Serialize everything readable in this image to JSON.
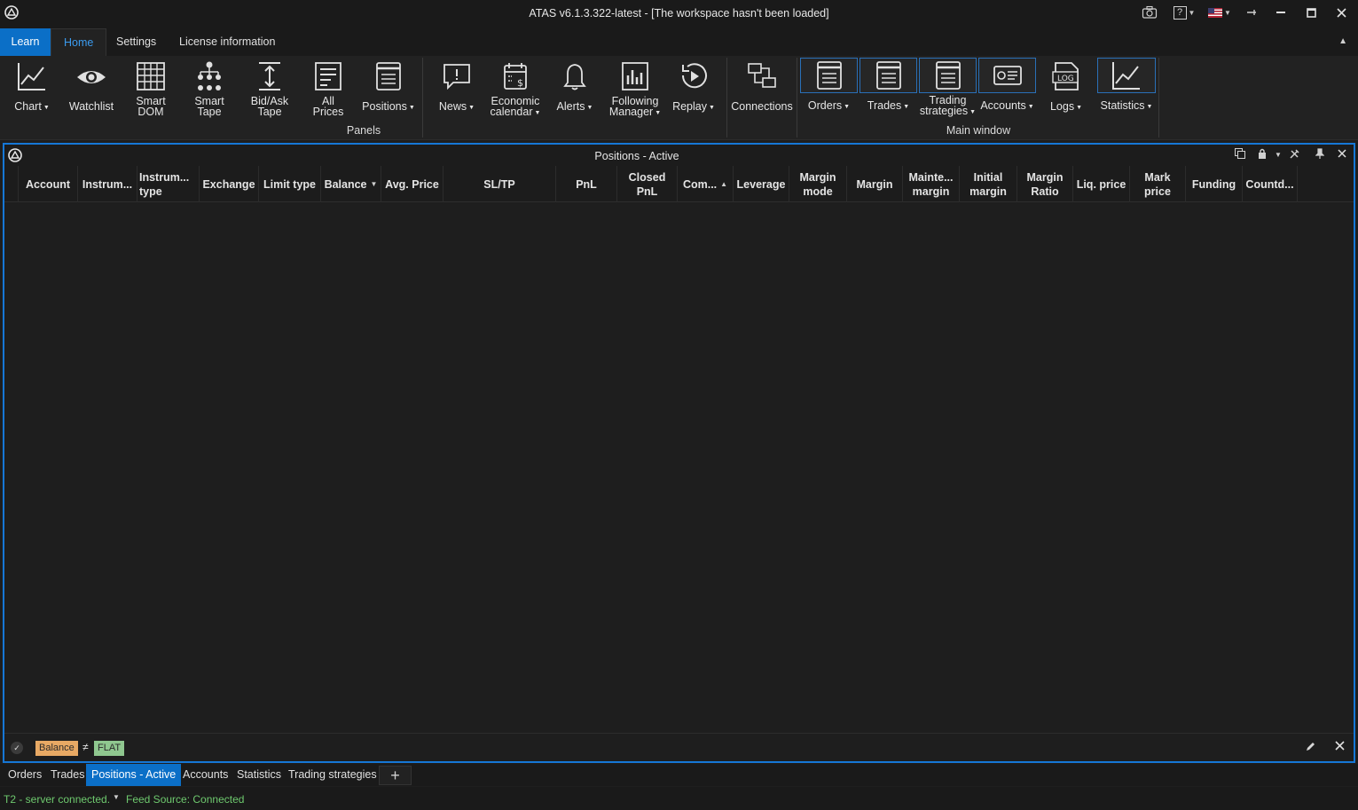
{
  "window": {
    "title": "ATAS v6.1.3.322-latest - [The workspace hasn't been loaded]"
  },
  "titlebar_icons": [
    "camera-icon",
    "help-icon",
    "flag-us-icon",
    "pin-icon",
    "minimize-icon",
    "maximize-icon",
    "close-icon"
  ],
  "ribbon_tabs": {
    "learn": "Learn",
    "home": "Home",
    "settings": "Settings",
    "license": "License information"
  },
  "ribbon": {
    "chart": "Chart",
    "watchlist": "Watchlist",
    "smart_dom_1": "Smart",
    "smart_dom_2": "DOM",
    "smart_tape_1": "Smart",
    "smart_tape_2": "Tape",
    "bidask_1": "Bid/Ask",
    "bidask_2": "Tape",
    "allprices_1": "All",
    "allprices_2": "Prices",
    "positions": "Positions",
    "news": "News",
    "econ_1": "Economic",
    "econ_2": "calendar",
    "alerts": "Alerts",
    "following_1": "Following",
    "following_2": "Manager",
    "replay": "Replay",
    "connections": "Connections",
    "orders": "Orders",
    "trades": "Trades",
    "trading_strat_1": "Trading",
    "trading_strat_2": "strategies",
    "accounts": "Accounts",
    "logs": "Logs",
    "statistics": "Statistics",
    "log_icon_text": "LOG",
    "group_panels": "Panels",
    "group_main": "Main window"
  },
  "panel": {
    "title": "Positions - Active"
  },
  "columns": [
    {
      "line1": "Account",
      "line2": ""
    },
    {
      "line1": "Instrum...",
      "line2": ""
    },
    {
      "line1": "Instrum...",
      "line2": "type"
    },
    {
      "line1": "Exchange",
      "line2": ""
    },
    {
      "line1": "Limit type",
      "line2": ""
    },
    {
      "line1": "Balance",
      "line2": ""
    },
    {
      "line1": "Avg. Price",
      "line2": ""
    },
    {
      "line1": "SL/TP",
      "line2": ""
    },
    {
      "line1": "PnL",
      "line2": ""
    },
    {
      "line1": "Closed",
      "line2": "PnL"
    },
    {
      "line1": "Com...",
      "line2": ""
    },
    {
      "line1": "Leverage",
      "line2": ""
    },
    {
      "line1": "Margin",
      "line2": "mode"
    },
    {
      "line1": "Margin",
      "line2": ""
    },
    {
      "line1": "Mainte...",
      "line2": "margin"
    },
    {
      "line1": "Initial",
      "line2": "margin"
    },
    {
      "line1": "Margin",
      "line2": "Ratio"
    },
    {
      "line1": "Liq. price",
      "line2": ""
    },
    {
      "line1": "Mark",
      "line2": "price"
    },
    {
      "line1": "Funding",
      "line2": ""
    },
    {
      "line1": "Countd...",
      "line2": ""
    }
  ],
  "column_indicators": {
    "balance": "filter-icon",
    "commission": "sort-ascending-icon"
  },
  "filter": {
    "field": "Balance",
    "operator": "≠",
    "value": "FLAT"
  },
  "doc_tabs": {
    "orders": "Orders",
    "trades": "Trades",
    "positions_active": "Positions - Active",
    "accounts": "Accounts",
    "statistics": "Statistics",
    "trading_strategies": "Trading strategies",
    "add": "+"
  },
  "status": {
    "server": "T2 - server connected.",
    "feed": "Feed Source: Connected"
  },
  "colors": {
    "accent": "#0b6fc7",
    "panel_border": "#1677d6",
    "active_tab_text": "#3b9cf0",
    "status_ok": "#6ec96e",
    "filter_field_chip": "#e8a964",
    "filter_value_chip": "#8fc78f"
  }
}
